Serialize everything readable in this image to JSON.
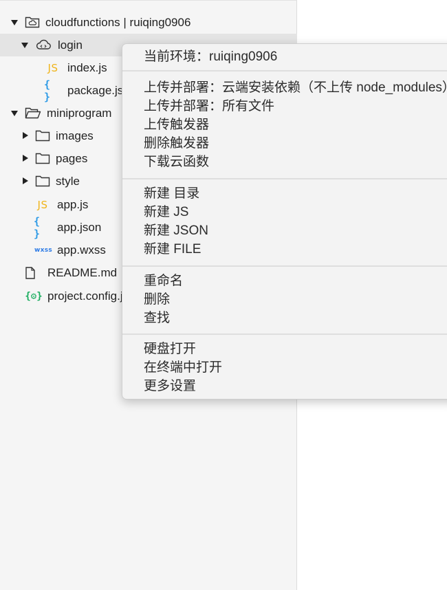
{
  "tree": {
    "cloudfunctions": "cloudfunctions | ruiqing0906",
    "login": "login",
    "index_js": "index.js",
    "package_json": "package.json",
    "miniprogram": "miniprogram",
    "images": "images",
    "pages": "pages",
    "style": "style",
    "app_js": "app.js",
    "app_json": "app.json",
    "app_wxss": "app.wxss",
    "readme": "README.md",
    "project_config": "project.config.json"
  },
  "icons": {
    "js": "JS",
    "json": "{ }",
    "wxss": "wxss",
    "config": "{⚙}"
  },
  "menu": {
    "env": "当前环境：ruiqing0906",
    "upload_cloud_install": "上传并部署：云端安装依赖（不上传 node_modules）",
    "upload_all": "上传并部署：所有文件",
    "upload_trigger": "上传触发器",
    "delete_trigger": "删除触发器",
    "download_function": "下载云函数",
    "new_dir": "新建 目录",
    "new_js": "新建 JS",
    "new_json": "新建 JSON",
    "new_file": "新建 FILE",
    "rename": "重命名",
    "delete": "删除",
    "find": "查找",
    "open_disk": "硬盘打开",
    "open_terminal": "在终端中打开",
    "more_settings": "更多设置"
  }
}
